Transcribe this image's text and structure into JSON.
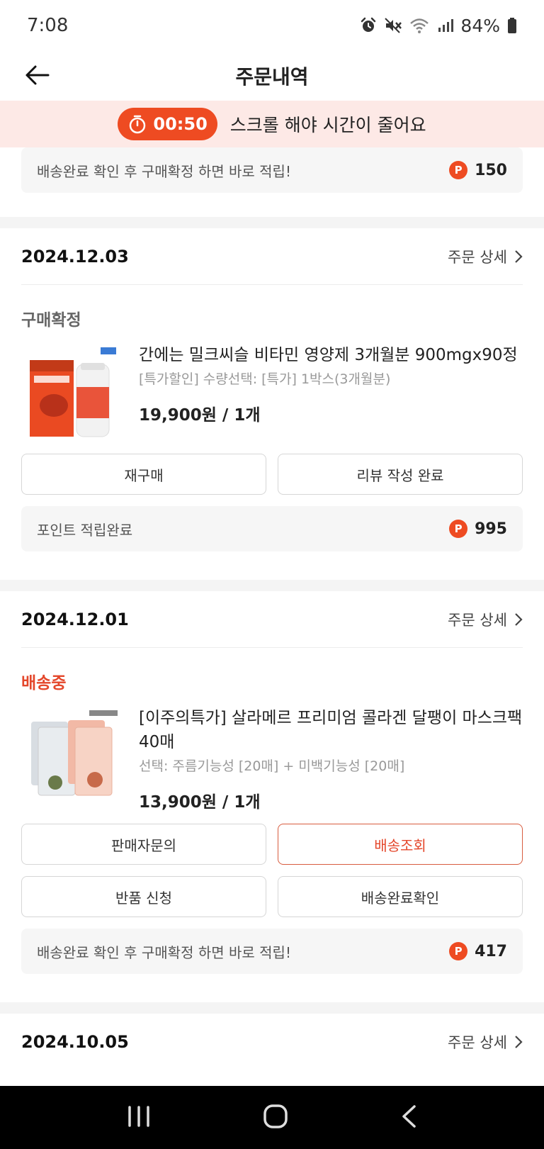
{
  "status_bar": {
    "time": "7:08",
    "battery": "84%",
    "icons": [
      "alarm-icon",
      "mute-icon",
      "wifi-icon",
      "signal-icon",
      "battery-icon"
    ]
  },
  "header": {
    "title": "주문내역",
    "back_icon": "back-arrow-icon"
  },
  "timer_banner": {
    "countdown": "00:50",
    "message": "스크롤 해야 시간이 줄어요",
    "accent_color": "#ee4b22",
    "background": "#fde9e6"
  },
  "top_points": {
    "label": "배송완료 확인 후 구매확정 하면 바로 적립!",
    "badge": "P",
    "value": "150"
  },
  "orders": [
    {
      "date": "2024.12.03",
      "detail_link": "주문 상세",
      "status": "구매확정",
      "product": {
        "name": "간에는 밀크씨슬 비타민 영양제 3개월분 900mgx90정",
        "option": "[특가할인] 수량선택: [특가] 1박스(3개월분)",
        "price": "19,900원 / 1개"
      },
      "buttons": [
        "재구매",
        "리뷰 작성 완료"
      ],
      "points": {
        "label": "포인트 적립완료",
        "badge": "P",
        "value": "995"
      }
    },
    {
      "date": "2024.12.01",
      "detail_link": "주문 상세",
      "status": "배송중",
      "product": {
        "name": "[이주의특가] 살라메르 프리미엄 콜라겐 달팽이 마스크팩 40매",
        "option": "선택: 주름기능성 [20매] + 미백기능성 [20매]",
        "price": "13,900원 / 1개"
      },
      "buttons": [
        "판매자문의",
        "배송조회",
        "반품 신청",
        "배송완료확인"
      ],
      "points": {
        "label": "배송완료 확인 후 구매확정 하면 바로 적립!",
        "badge": "P",
        "value": "417"
      }
    },
    {
      "date": "2024.10.05",
      "detail_link": "주문 상세"
    }
  ],
  "nav_bar": {
    "icons": [
      "recent-apps-icon",
      "home-icon",
      "back-icon"
    ]
  }
}
